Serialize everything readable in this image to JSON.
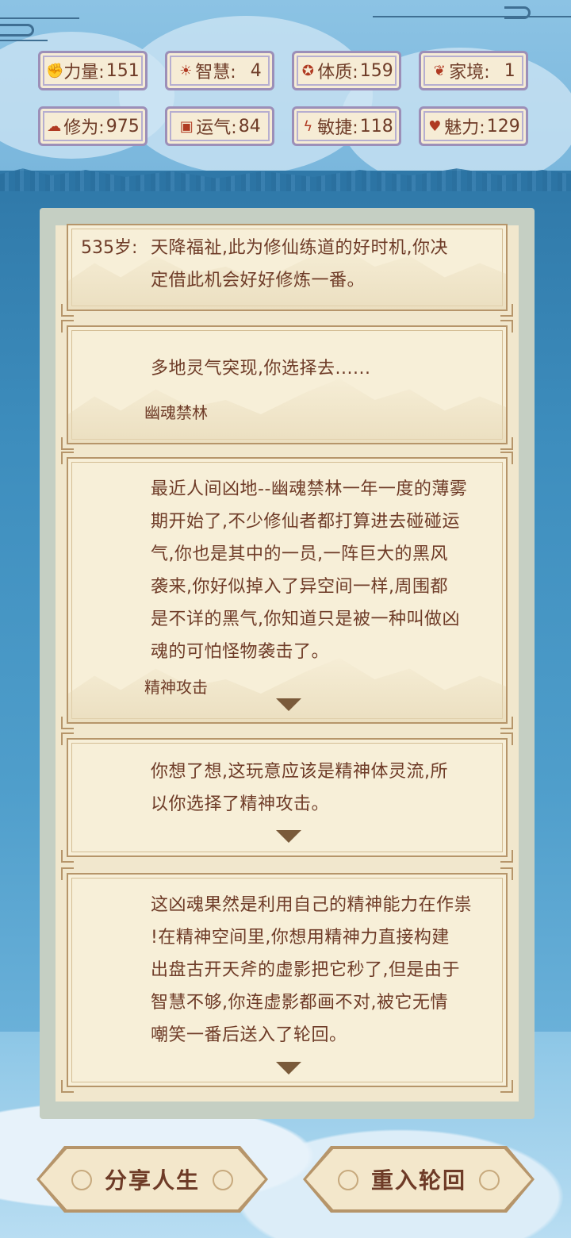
{
  "stats": [
    {
      "icon": "muscle-icon",
      "label": "力量:",
      "value": "151"
    },
    {
      "icon": "bulb-icon",
      "label": "智慧:",
      "value": "4"
    },
    {
      "icon": "body-icon",
      "label": "体质:",
      "value": "159"
    },
    {
      "icon": "family-icon",
      "label": "家境:",
      "value": "1"
    },
    {
      "icon": "cloud-icon",
      "label": "修为:",
      "value": "975"
    },
    {
      "icon": "dice-icon",
      "label": "运气:",
      "value": "84"
    },
    {
      "icon": "lightning-icon",
      "label": "敏捷:",
      "value": "118"
    },
    {
      "icon": "heart-icon",
      "label": "魅力:",
      "value": "129"
    }
  ],
  "log": {
    "entry1": {
      "age": "535岁:",
      "lines": [
        "天降福祉,此为修仙练道的好时机,你决",
        "定借此机会好好修炼一番。"
      ]
    },
    "entry2": {
      "lines": [
        "多地灵气突现,你选择去......"
      ],
      "choice": "幽魂禁林"
    },
    "entry3": {
      "lines": [
        "最近人间凶地--幽魂禁林一年一度的薄雾",
        "期开始了,不少修仙者都打算进去碰碰运",
        "气,你也是其中的一员,一阵巨大的黑风",
        "袭来,你好似掉入了异空间一样,周围都",
        "是不详的黑气,你知道只是被一种叫做凶",
        "魂的可怕怪物袭击了。"
      ],
      "choice": "精神攻击"
    },
    "entry4": {
      "lines": [
        "你想了想,这玩意应该是精神体灵流,所",
        "以你选择了精神攻击。"
      ]
    },
    "entry5": {
      "lines": [
        "这凶魂果然是利用自己的精神能力在作祟",
        "!在精神空间里,你想用精神力直接构建",
        "出盘古开天斧的虚影把它秒了,但是由于",
        "智慧不够,你连虚影都画不对,被它无情",
        "嘲笑一番后送入了轮回。"
      ]
    }
  },
  "buttons": {
    "share": "分享人生",
    "restart": "重入轮回"
  }
}
